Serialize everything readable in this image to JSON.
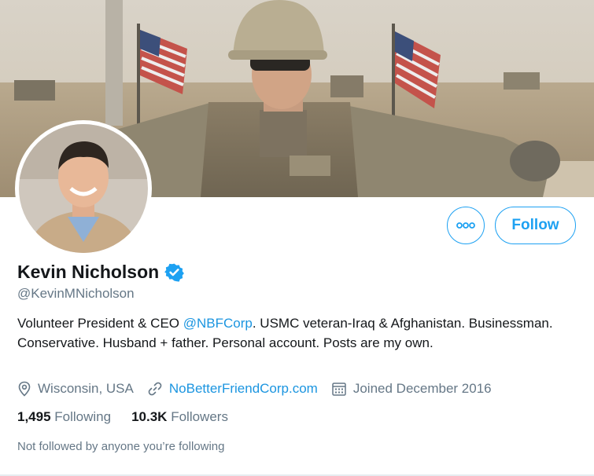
{
  "profile": {
    "name": "Kevin Nicholson",
    "handle": "@KevinMNicholson",
    "bio_prefix": "Volunteer President & CEO ",
    "bio_mention": "@NBFCorp",
    "bio_suffix": ". USMC veteran-Iraq & Afghanistan. Businessman. Conservative. Husband + father. Personal account. Posts are my own.",
    "location": "Wisconsin, USA",
    "website": "NoBetterFriendCorp.com",
    "joined": "Joined December 2016",
    "following_count": "1,495",
    "following_label": "Following",
    "followers_count": "10.3K",
    "followers_label": "Followers",
    "social_context": "Not followed by anyone you’re following"
  },
  "actions": {
    "follow_label": "Follow",
    "more_icon": "more-dots-icon"
  },
  "colors": {
    "accent": "#1da1f2",
    "link": "#1b95e0",
    "secondary_text": "#657786",
    "primary_text": "#14171a"
  }
}
